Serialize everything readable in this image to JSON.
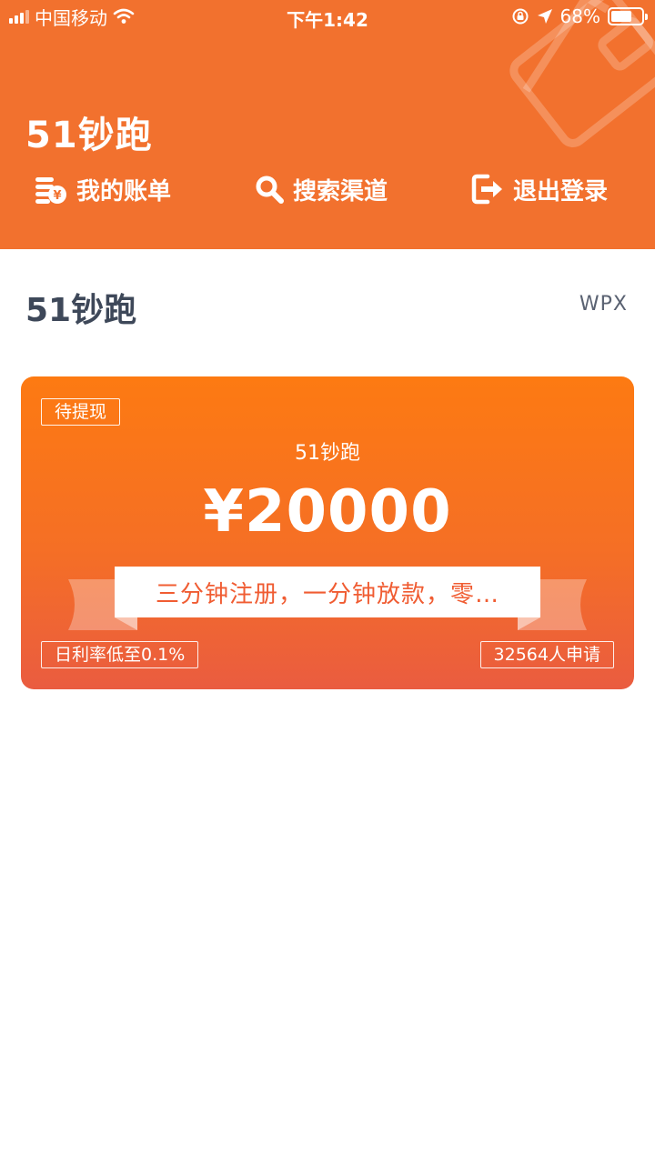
{
  "status_bar": {
    "carrier": "中国移动",
    "time": "下午1:42",
    "battery": "68%",
    "battery_level": 0.68
  },
  "header": {
    "title": "51钞跑",
    "nav": [
      {
        "label": "我的账单",
        "icon": "bill-coins-icon"
      },
      {
        "label": "搜索渠道",
        "icon": "search-icon"
      },
      {
        "label": "退出登录",
        "icon": "logout-icon"
      }
    ]
  },
  "section": {
    "title": "51钞跑",
    "user": "WPX"
  },
  "card": {
    "status_tag": "待提现",
    "name": "51钞跑",
    "amount": "¥20000",
    "slogan": "三分钟注册，一分钟放款，零…",
    "rate_tag": "日利率低至0.1%",
    "applicants_tag": "32564人申请"
  },
  "colors": {
    "header_bg": "#f2712e",
    "card_top": "#fd7a12",
    "card_bottom": "#ea5c40",
    "slogan_text": "#f05c32",
    "section_title": "#3e4859"
  }
}
